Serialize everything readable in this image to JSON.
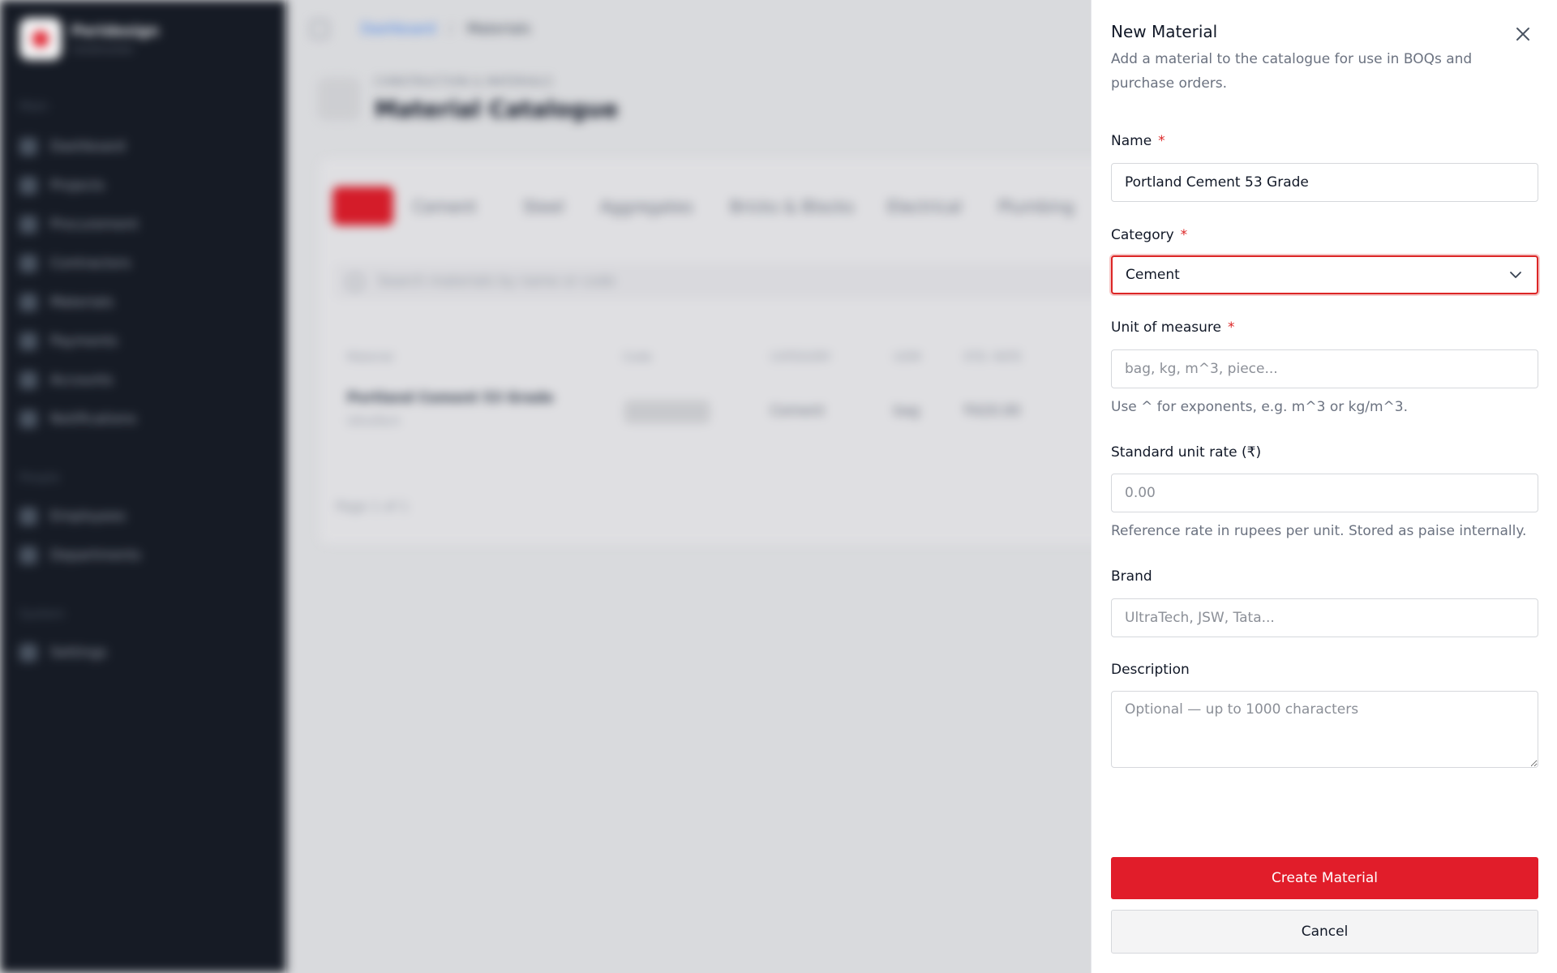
{
  "app": {
    "brand_name": "Peridesign",
    "brand_sub": "Construction"
  },
  "sidebar": {
    "sections": [
      {
        "label": "Main"
      },
      {
        "label": "People"
      },
      {
        "label": "System"
      }
    ],
    "items": [
      {
        "label": "Dashboard",
        "icon": "grid-icon"
      },
      {
        "label": "Projects",
        "icon": "folder-icon"
      },
      {
        "label": "Procurement",
        "icon": "cart-icon"
      },
      {
        "label": "Contractors",
        "icon": "users-icon"
      },
      {
        "label": "Materials",
        "icon": "box-icon"
      },
      {
        "label": "Payments",
        "icon": "card-icon"
      },
      {
        "label": "Accounts",
        "icon": "ledger-icon"
      },
      {
        "label": "Notifications",
        "icon": "bell-icon"
      },
      {
        "label": "Employees",
        "icon": "user-icon"
      },
      {
        "label": "Departments",
        "icon": "building-icon"
      },
      {
        "label": "Settings",
        "icon": "gear-icon"
      }
    ]
  },
  "breadcrumb": {
    "root": "Dashboard",
    "separator": "/",
    "current": "Materials"
  },
  "page_header": {
    "kicker": "CONSTRUCTION & MATERIALS",
    "title": "Material Catalogue"
  },
  "catalogue": {
    "tabs": [
      {
        "label": "All"
      },
      {
        "label": "Cement"
      },
      {
        "label": "Steel"
      },
      {
        "label": "Aggregates"
      },
      {
        "label": "Bricks & Blocks"
      },
      {
        "label": "Electrical"
      },
      {
        "label": "Plumbing"
      }
    ],
    "search_placeholder": "Search materials by name or code",
    "columns": [
      "Material",
      "Code",
      "CATEGORY",
      "UOM",
      "STD. RATE"
    ],
    "rows": [
      {
        "name": "Portland Cement 53 Grade",
        "brand": "UltraTech",
        "code": "MAT-0001",
        "category": "Cement",
        "uom": "bag",
        "rate": "₹420.00"
      }
    ],
    "page_info": "Page 1 of 1"
  },
  "drawer": {
    "title": "New Material",
    "description": "Add a material to the catalogue for use in BOQs and purchase orders.",
    "close_icon": "close-icon",
    "required_mark": "*",
    "fields": {
      "name": {
        "label": "Name",
        "value": "Portland Cement 53 Grade"
      },
      "category": {
        "label": "Category",
        "value": "Cement",
        "icon": "chevron-down-icon"
      },
      "unit": {
        "label": "Unit of measure",
        "placeholder": "bag, kg, m^3, piece...",
        "hint": "Use ^ for exponents, e.g. m^3 or kg/m^3."
      },
      "rate": {
        "label": "Standard unit rate (₹)",
        "placeholder": "0.00",
        "hint": "Reference rate in rupees per unit. Stored as paise internally."
      },
      "brand": {
        "label": "Brand",
        "placeholder": "UltraTech, JSW, Tata..."
      },
      "description": {
        "label": "Description",
        "placeholder": "Optional — up to 1000 characters"
      }
    },
    "create_button": "Create Material",
    "cancel_button": "Cancel"
  },
  "colors": {
    "accent": "#e11d2a",
    "sidebar_bg": "#161b25",
    "focus_ring": "#dc2626"
  }
}
